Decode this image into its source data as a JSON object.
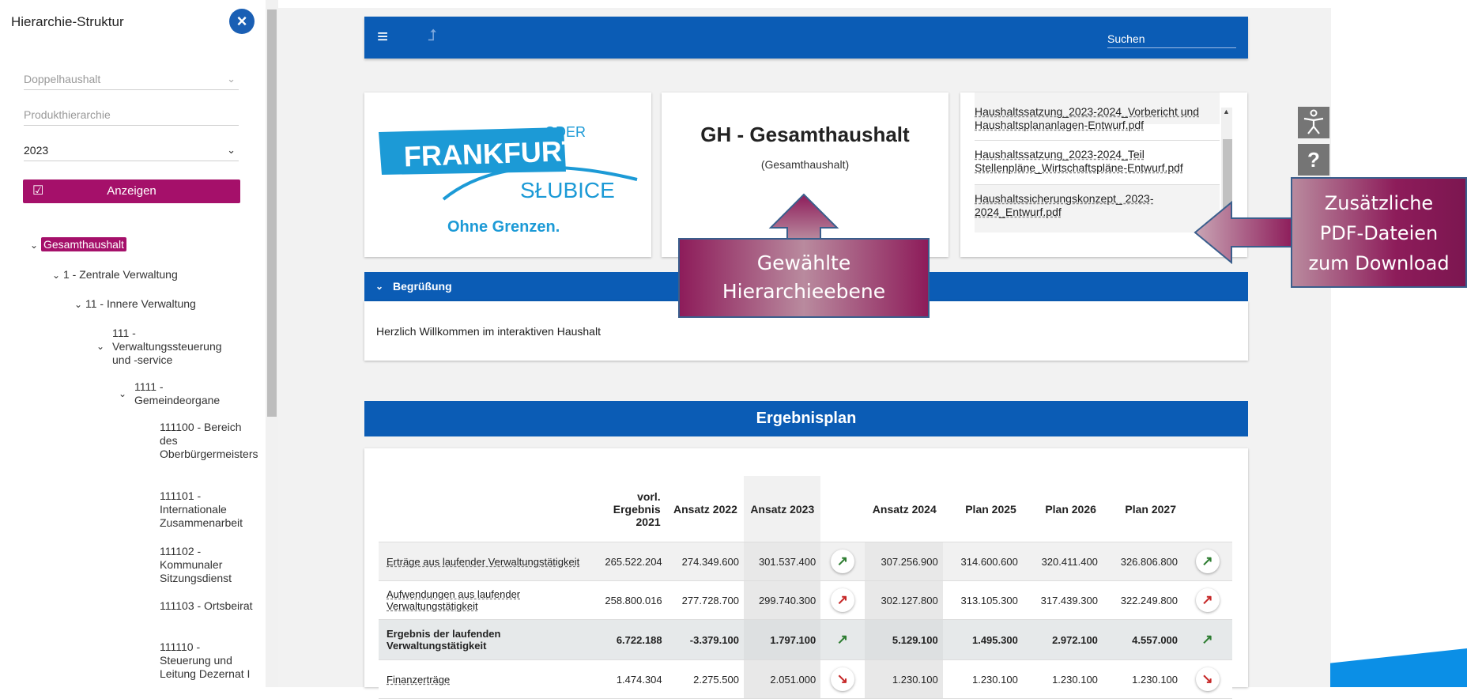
{
  "sidebar": {
    "title": "Hierarchie-Struktur",
    "select_haushalt": "Doppelhaushalt",
    "select_hierarchie": "Produkthierarchie",
    "select_year": "2023",
    "show_button": "Anzeigen",
    "tree": [
      "Gesamthaushalt",
      "1 - Zentrale Verwaltung",
      "11 - Innere Verwaltung",
      "111 - Verwaltungssteuerung und -service",
      "1111 - Gemeindeorgane",
      "111100 - Bereich des Oberbürgermeisters",
      "111101 - Internationale Zusammenarbeit",
      "111102 - Kommunaler Sitzungsdienst",
      "111103 - Ortsbeirat",
      "111110 - Steuerung und Leitung Dezernat I"
    ]
  },
  "topbar": {
    "search_placeholder": "Suchen"
  },
  "logo": {
    "oder": "ODER",
    "frankfurt": "FRANKFURT",
    "slubice": "SŁUBICE",
    "slogan": "Ohne Grenzen."
  },
  "hierarchy": {
    "title": "GH - Gesamthaushalt",
    "subtitle": "(Gesamthaushalt)"
  },
  "pdfs": [
    "Haushaltssatzung_2023-2024_Vorbericht und Haushaltsplananlagen-Entwurf.pdf",
    "Haushaltssatzung_2023-2024_Teil Stellenpläne_Wirtschaftspläne-Entwurf.pdf",
    "Haushaltssicherungskonzept_ 2023-2024_Entwurf.pdf"
  ],
  "greeting": {
    "header": "Begrüßung",
    "text": "Herzlich Willkommen im interaktiven Haushalt"
  },
  "ergebnisplan": {
    "title": "Ergebnisplan",
    "columns": [
      "vorl. Ergebnis 2021",
      "Ansatz 2022",
      "Ansatz 2023",
      "Ansatz 2024",
      "Plan 2025",
      "Plan 2026",
      "Plan 2027"
    ],
    "rows": [
      {
        "label": "Erträge aus laufender Verwaltungstätigkeit",
        "values": [
          "265.522.204",
          "274.349.600",
          "301.537.400",
          "307.256.900",
          "314.600.600",
          "320.411.400",
          "326.806.800"
        ],
        "trend": "up-green"
      },
      {
        "label": "Aufwendungen aus laufender Verwaltungstätigkeit",
        "values": [
          "258.800.016",
          "277.728.700",
          "299.740.300",
          "302.127.800",
          "313.105.300",
          "317.439.300",
          "322.249.800"
        ],
        "trend": "up-red"
      },
      {
        "label": "Ergebnis der laufenden Verwaltungstätigkeit",
        "values": [
          "6.722.188",
          "-3.379.100",
          "1.797.100",
          "5.129.100",
          "1.495.300",
          "2.972.100",
          "4.557.000"
        ],
        "trend": "up-green"
      },
      {
        "label": "Finanzerträge",
        "values": [
          "1.474.304",
          "2.275.500",
          "2.051.000",
          "1.230.100",
          "1.230.100",
          "1.230.100",
          "1.230.100"
        ],
        "trend": "down-red"
      }
    ]
  },
  "callouts": {
    "hierarchy": [
      "Gewählte",
      "Hierarchieebene"
    ],
    "pdf": [
      "Zusätzliche",
      "PDF-Dateien",
      "zum Download"
    ]
  },
  "side_icons": [
    "accessibility-icon",
    "help-icon"
  ],
  "colors": {
    "primary": "#0b5cb5",
    "accent": "#a5106a",
    "trend_up": "#2e7d32",
    "trend_down": "#c62828"
  }
}
